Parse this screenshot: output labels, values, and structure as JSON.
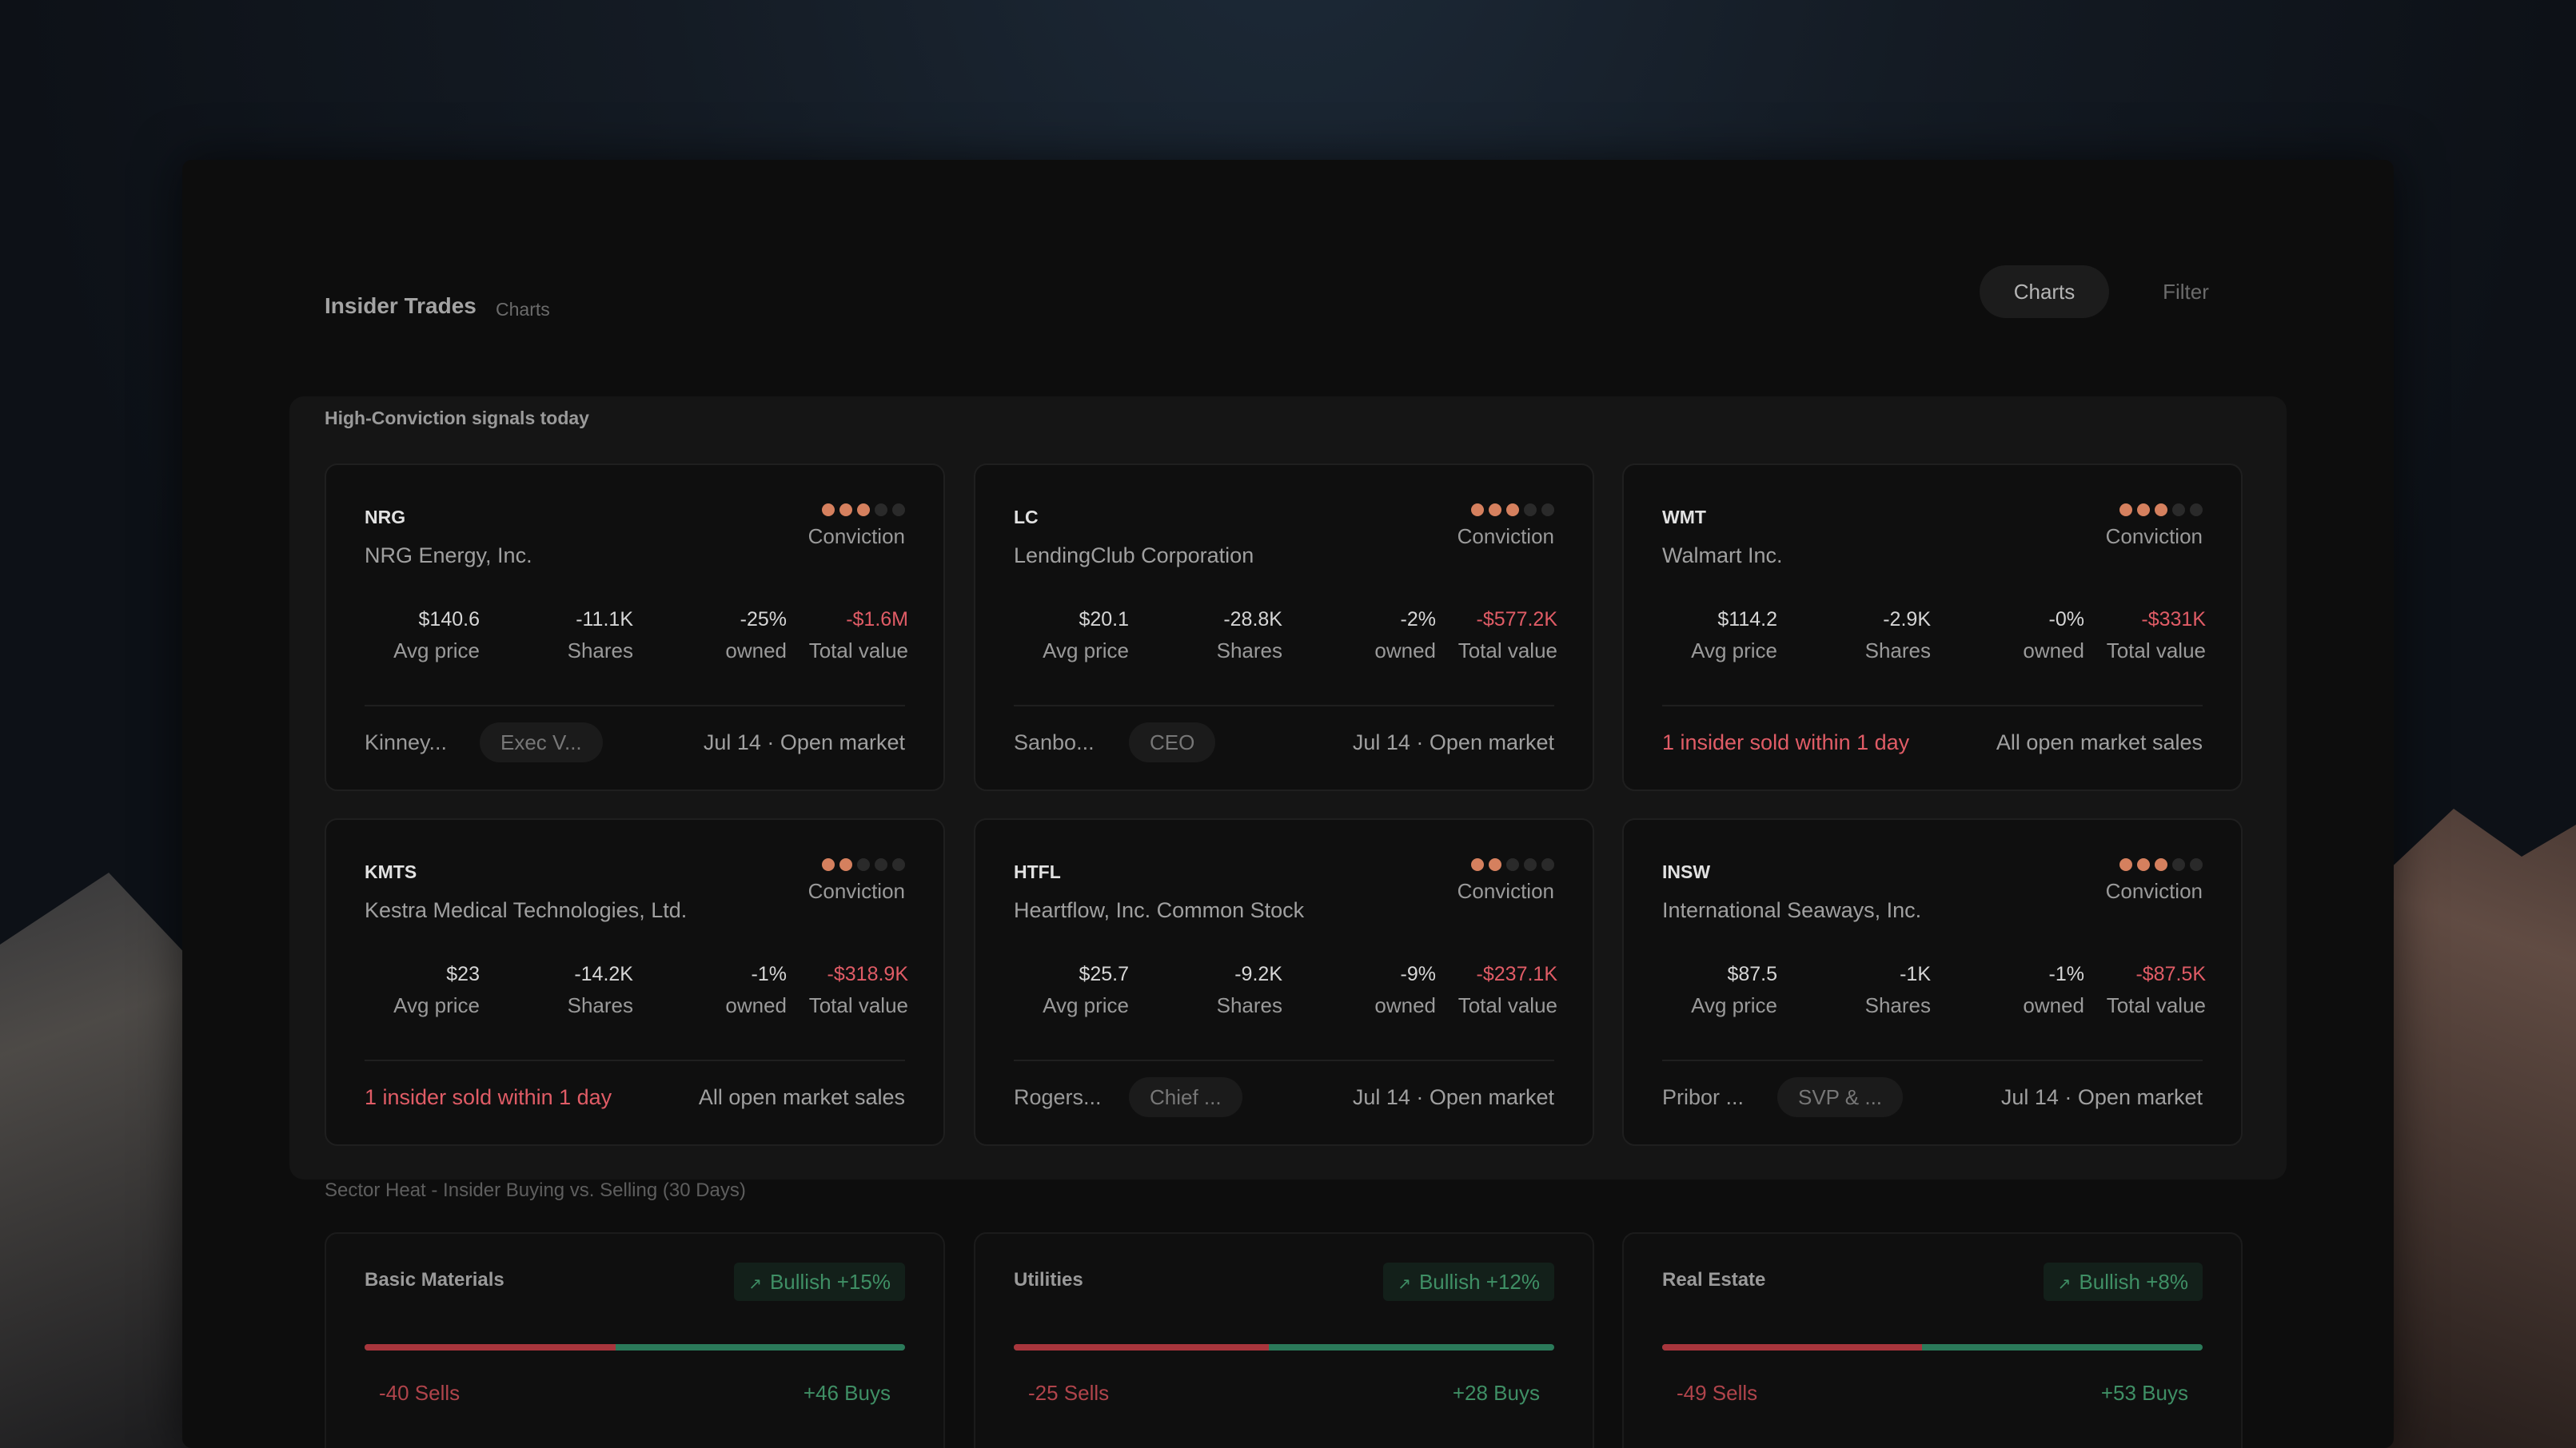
{
  "header": {
    "title": "Insider Trades",
    "subtitle": "Charts"
  },
  "nav": {
    "charts": "Charts",
    "filter": "Filter"
  },
  "signals_title": "High-Conviction signals today",
  "conviction_label": "Conviction",
  "stat_labels": {
    "avg": "Avg price",
    "shares": "Shares",
    "owned": "owned",
    "total": "Total value"
  },
  "cards": [
    {
      "ticker": "NRG",
      "company": "NRG Energy, Inc.",
      "conviction": 3,
      "avg_price": "$140.6",
      "shares": "-11.1K",
      "owned": "-25%",
      "total_value": "-$1.6M",
      "insider": "Kinney...",
      "role": "Exec V...",
      "meta": "Jul 14 · Open market"
    },
    {
      "ticker": "LC",
      "company": "LendingClub Corporation",
      "conviction": 3,
      "avg_price": "$20.1",
      "shares": "-28.8K",
      "owned": "-2%",
      "total_value": "-$577.2K",
      "insider": "Sanbo...",
      "role": "CEO",
      "meta": "Jul 14 · Open market"
    },
    {
      "ticker": "WMT",
      "company": "Walmart Inc.",
      "conviction": 3,
      "avg_price": "$114.2",
      "shares": "-2.9K",
      "owned": "-0%",
      "total_value": "-$331K",
      "alert": "1 insider sold within 1 day",
      "meta": "All open market sales"
    },
    {
      "ticker": "KMTS",
      "company": "Kestra Medical Technologies, Ltd.",
      "conviction": 2,
      "avg_price": "$23",
      "shares": "-14.2K",
      "owned": "-1%",
      "total_value": "-$318.9K",
      "alert": "1 insider sold within 1 day",
      "meta": "All open market sales"
    },
    {
      "ticker": "HTFL",
      "company": "Heartflow, Inc. Common Stock",
      "conviction": 2,
      "avg_price": "$25.7",
      "shares": "-9.2K",
      "owned": "-9%",
      "total_value": "-$237.1K",
      "insider": "Rogers...",
      "role": "Chief ...",
      "meta": "Jul 14 · Open market"
    },
    {
      "ticker": "INSW",
      "company": "International Seaways, Inc.",
      "conviction": 3,
      "avg_price": "$87.5",
      "shares": "-1K",
      "owned": "-1%",
      "total_value": "-$87.5K",
      "insider": "Pribor ...",
      "role": "SVP & ...",
      "meta": "Jul 14 · Open market"
    }
  ],
  "sector_title": "Sector Heat - Insider Buying vs. Selling (30 Days)",
  "sectors": [
    {
      "name": "Basic Materials",
      "badge": "Bullish +15%",
      "sells": "-40 Sells",
      "buys": "+46 Buys",
      "sell_count": 40,
      "buy_count": 46
    },
    {
      "name": "Utilities",
      "badge": "Bullish +12%",
      "sells": "-25 Sells",
      "buys": "+28 Buys",
      "sell_count": 25,
      "buy_count": 28
    },
    {
      "name": "Real Estate",
      "badge": "Bullish +8%",
      "sells": "-49 Sells",
      "buys": "+53 Buys",
      "sell_count": 49,
      "buy_count": 53
    }
  ],
  "colors": {
    "conviction_dot": "#d5805e",
    "negative": "#e05c66",
    "bullish": "#3f8f65",
    "sell_bar": "#a8353c",
    "buy_bar": "#2b7a5a"
  }
}
